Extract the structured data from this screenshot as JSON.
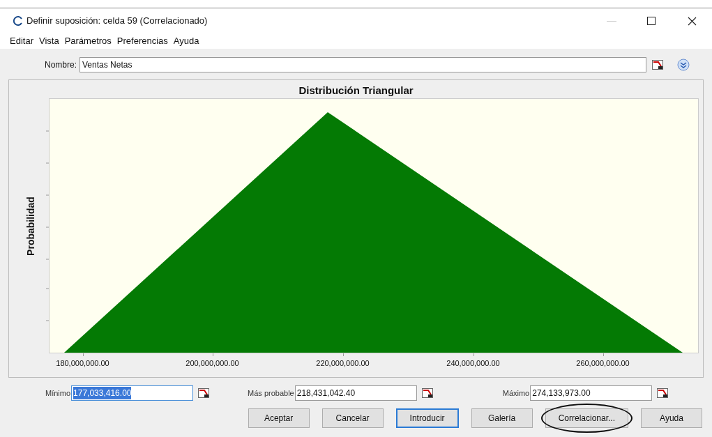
{
  "window": {
    "title": "Definir suposición: celda 59 (Correlacionado)"
  },
  "menu": [
    "Editar",
    "Vista",
    "Parámetros",
    "Preferencias",
    "Ayuda"
  ],
  "name_field": {
    "label": "Nombre:",
    "value": "Ventas Netas"
  },
  "chart": {
    "title": "Distribución Triangular",
    "ylabel": "Probabilidad",
    "xtick_labels": [
      "180,000,000.00",
      "200,000,000.00",
      "220,000,000.00",
      "240,000,000.00",
      "260,000,000.00"
    ]
  },
  "parameters": [
    {
      "label": "Mínimo",
      "value": "177,033,416.00",
      "selected": true
    },
    {
      "label": "Más probable",
      "value": "218,431,042.40",
      "selected": false
    },
    {
      "label": "Máximo",
      "value": "274,133,973.00",
      "selected": false
    }
  ],
  "buttons": [
    {
      "label": "Aceptar",
      "focused": false,
      "circled": false
    },
    {
      "label": "Cancelar",
      "focused": false,
      "circled": false
    },
    {
      "label": "Introducir",
      "focused": true,
      "circled": false
    },
    {
      "label": "Galería",
      "focused": false,
      "circled": false
    },
    {
      "label": "Correlacionar...",
      "focused": false,
      "circled": true
    },
    {
      "label": "Ayuda",
      "focused": false,
      "circled": false
    }
  ]
}
